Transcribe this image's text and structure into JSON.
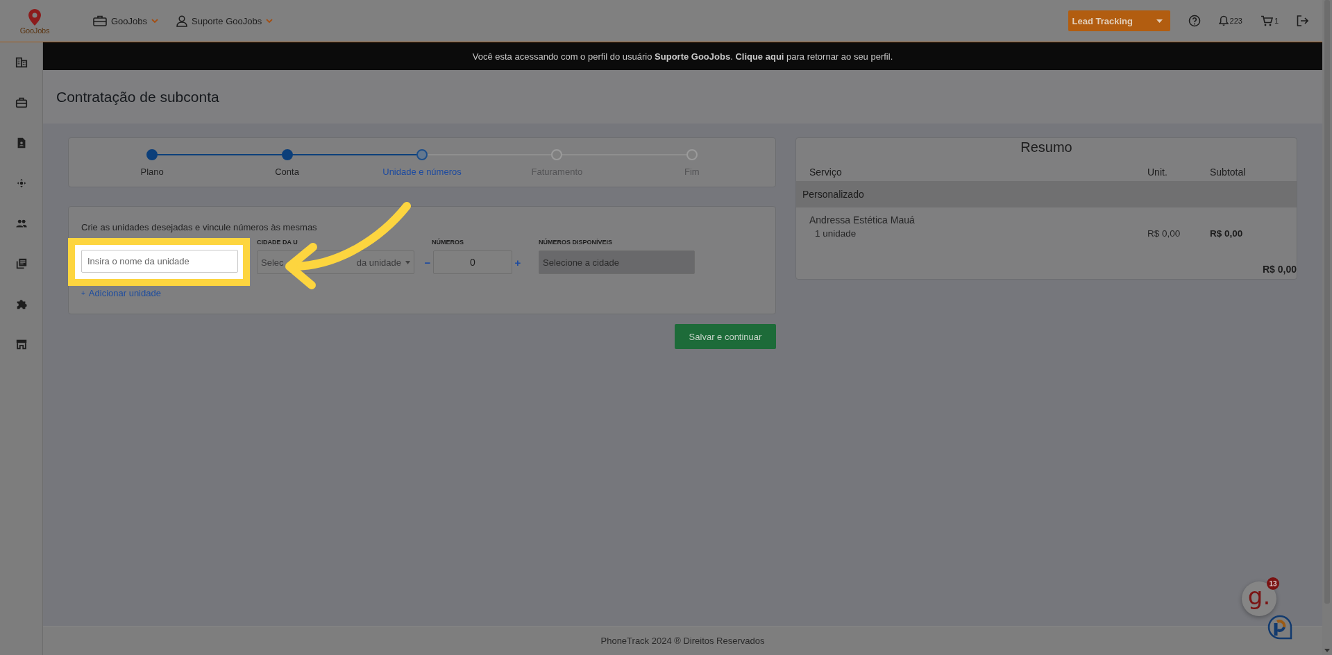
{
  "topbar": {
    "logo_text": "GooJobs",
    "menus": [
      {
        "label": "GooJobs"
      },
      {
        "label": "Suporte GooJobs"
      }
    ],
    "lead_button": "Lead Tracking",
    "notifications_count": "223",
    "cart_count": "1"
  },
  "banner": {
    "text": "Você esta acessando com o perfil do usuário **Suporte GooJobs**. **Clique aqui** para retornar ao seu perfil."
  },
  "page_title": "Contratação de subconta",
  "stepper": {
    "steps": [
      {
        "label": "Plano",
        "completed": true,
        "selected": false
      },
      {
        "label": "Conta",
        "completed": true,
        "selected": false
      },
      {
        "label": "Unidade e números",
        "completed": false,
        "selected": true
      },
      {
        "label": "Faturamento",
        "completed": false,
        "selected": false
      },
      {
        "label": "Fim",
        "completed": false,
        "selected": false
      }
    ]
  },
  "unit_form": {
    "intro": "Crie as unidades desejadas e vincule números às mesmas",
    "name_field": {
      "placeholder": "Insira o nome da unidade"
    },
    "city_label": "CIDADE DA U",
    "city_select": {
      "text_start": "Selec",
      "text_end": "da unidade"
    },
    "numbers_label": "NÚMEROS",
    "decrement": "−",
    "numbers_value": "0",
    "increment": "+",
    "available_label": "NÚMEROS DISPONÍVEIS",
    "available_field": {
      "placeholder": "Selecione a cidade",
      "disabled": true
    },
    "add_icon": "+",
    "add_link": "Adicionar unidade"
  },
  "save_button": "Salvar e continuar",
  "summary": {
    "title": "Resumo",
    "columns": [
      "Serviço",
      "Unit.",
      "Subtotal"
    ],
    "group": "Personalizado",
    "item": {
      "name": "Andressa Estética Mauá",
      "detail": "1 unidade",
      "unit": "R$ 0,00",
      "subtotal": "R$ 0,00"
    },
    "total": "R$ 0,00"
  },
  "footer": "PhoneTrack 2024 ® Direitos Reservados",
  "chat": {
    "logo": "g.",
    "badge": "13"
  }
}
